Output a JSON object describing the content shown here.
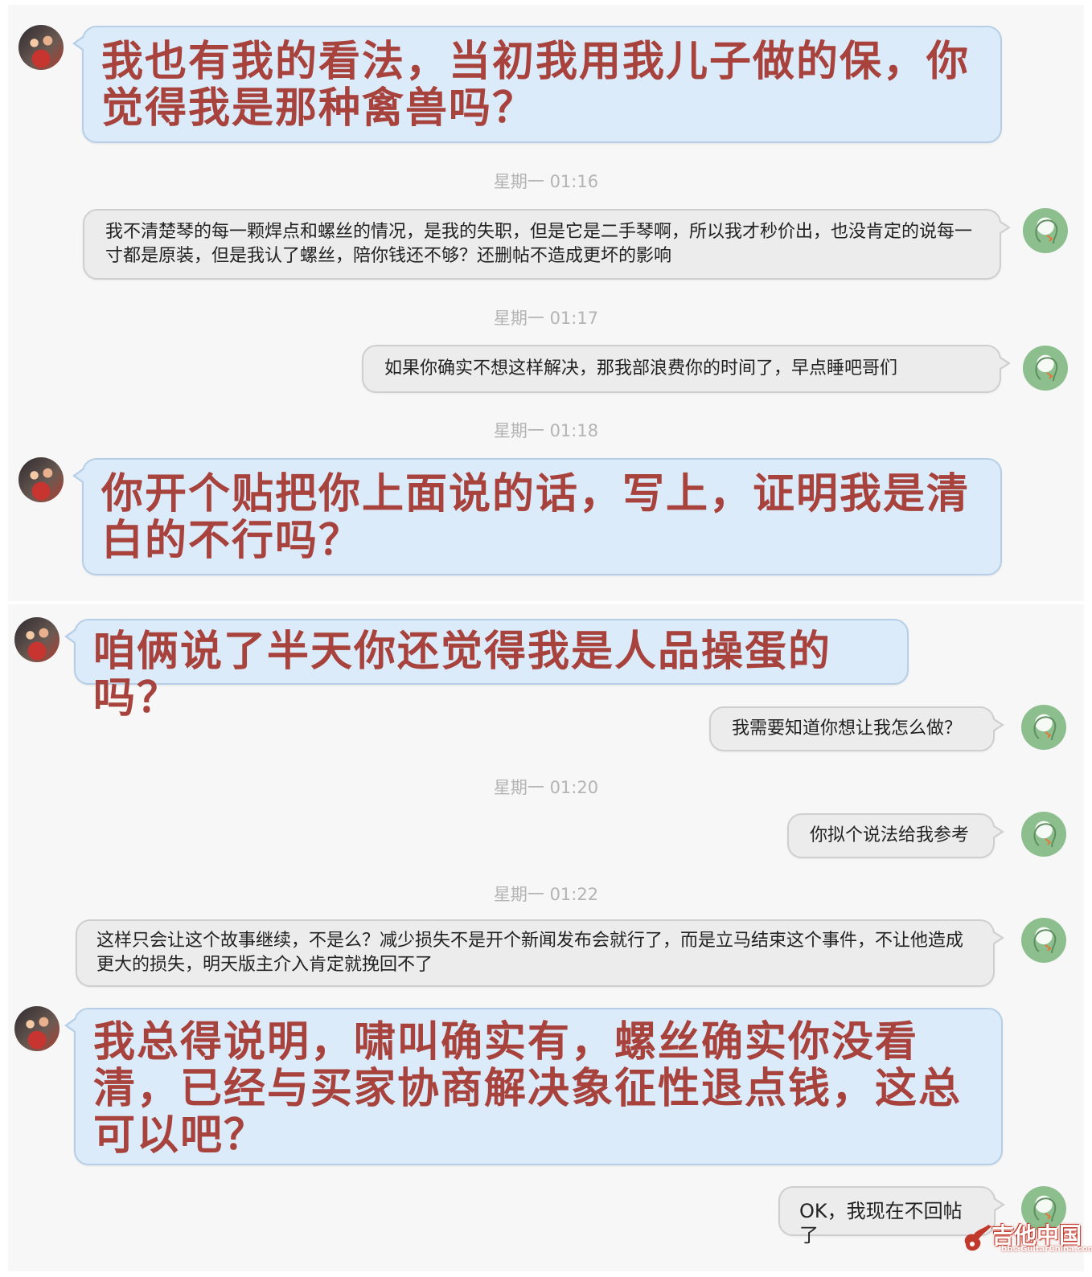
{
  "panel1": {
    "messages": [
      {
        "text": "我也有我的看法，当初我用我儿子做的保，你觉得我是那种禽兽吗？"
      },
      {
        "text": "我不清楚琴的每一颗焊点和螺丝的情况，是我的失职，但是它是二手琴啊，所以我才秒价出，也没肯定的说每一寸都是原装，但是我认了螺丝，陪你钱还不够？还删帖不造成更坏的影响"
      },
      {
        "text": "如果你确实不想这样解决，那我部浪费你的时间了，早点睡吧哥们"
      },
      {
        "text": "你开个贴把你上面说的话，写上，证明我是清白的不行吗？"
      }
    ],
    "timestamps": [
      "星期一  01:16",
      "星期一  01:17",
      "星期一  01:18"
    ]
  },
  "panel2": {
    "messages": [
      {
        "text": "咱俩说了半天你还觉得我是人品操蛋的吗？"
      },
      {
        "text": "我需要知道你想让我怎么做？"
      },
      {
        "text": "你拟个说法给我参考"
      },
      {
        "text": "这样只会让这个故事继续，不是么？减少损失不是开个新闻发布会就行了，而是立马结束这个事件，不让他造成更大的损失，明天版主介入肯定就挽回不了"
      },
      {
        "text": "我总得说明，啸叫确实有，螺丝确实你没看清，已经与买家协商解决象征性退点钱，这总可以吧？"
      },
      {
        "text": "OK，我现在不回帖了"
      }
    ],
    "timestamps": [
      "星期一  01:20",
      "星期一  01:22"
    ]
  },
  "watermark": {
    "main": "吉他中国",
    "sub": "bbs.GuitarChina.com"
  },
  "colors": {
    "left_bubble": "#dbebfa",
    "right_bubble": "#ececec",
    "emphasis_text": "#a8423c",
    "timestamp": "#b4b4b4"
  },
  "icons": {
    "left_avatar": "family-photo-avatar",
    "right_avatar": "default-head-avatar"
  }
}
